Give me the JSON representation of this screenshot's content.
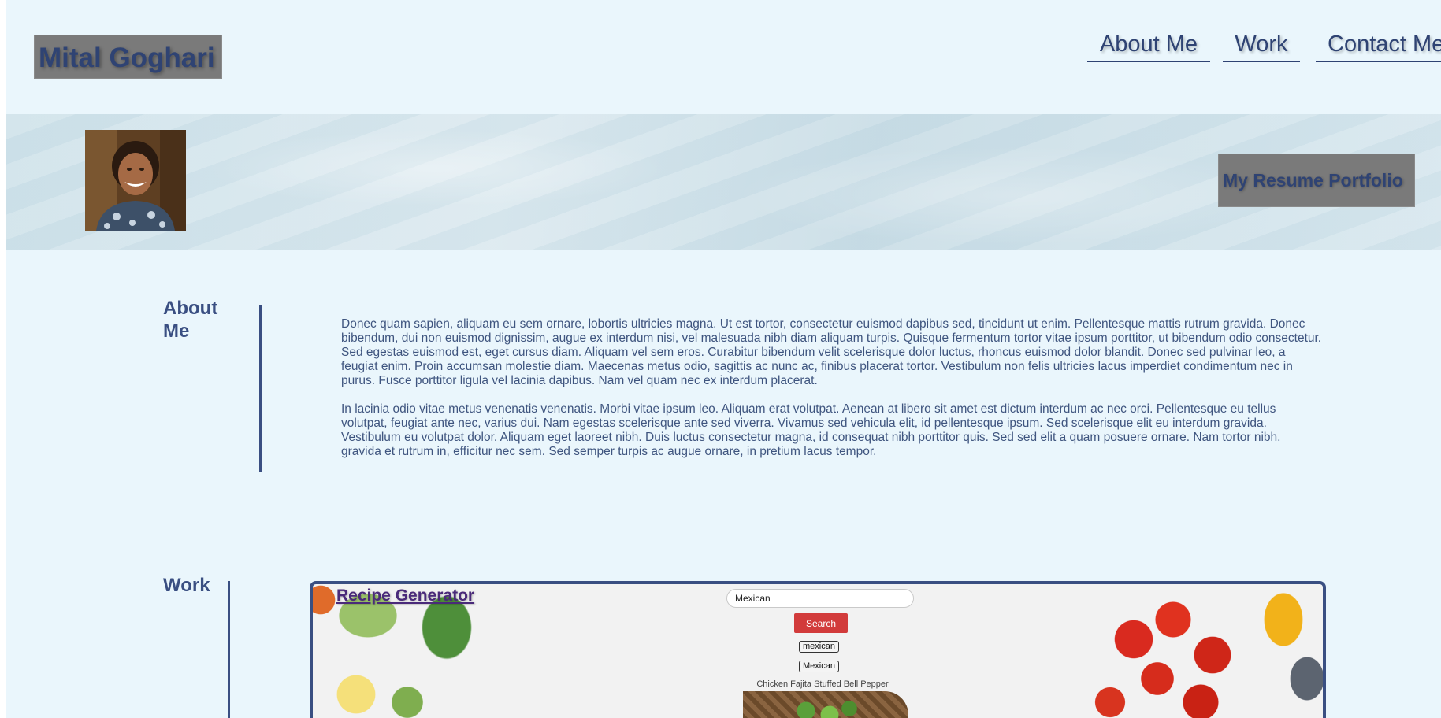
{
  "header": {
    "site_title": "Mital Goghari",
    "nav": {
      "about": "About Me",
      "work": "Work",
      "contact": "Contact Me"
    }
  },
  "banner": {
    "badge_text": "My Resume Portfolio",
    "avatar_icon": "profile-photo"
  },
  "about": {
    "heading": "About Me",
    "paragraphs": [
      "Donec quam sapien, aliquam eu sem ornare, lobortis ultricies magna. Ut est tortor, consectetur euismod dapibus sed, tincidunt ut enim. Pellentesque mattis rutrum gravida. Donec bibendum, dui non euismod dignissim, augue ex interdum nisi, vel malesuada nibh diam aliquam turpis. Quisque fermentum tortor vitae ipsum porttitor, ut bibendum odio consectetur. Sed egestas euismod est, eget cursus diam. Aliquam vel sem eros. Curabitur bibendum velit scelerisque dolor luctus, rhoncus euismod dolor blandit. Donec sed pulvinar leo, a feugiat enim. Proin accumsan molestie diam. Maecenas metus odio, sagittis ac nunc ac, finibus placerat tortor. Vestibulum non felis ultricies lacus imperdiet condimentum nec in purus. Fusce porttitor ligula vel lacinia dapibus. Nam vel quam nec ex interdum placerat.",
      "In lacinia odio vitae metus venenatis venenatis. Morbi vitae ipsum leo. Aliquam erat volutpat. Aenean at libero sit amet est dictum interdum ac nec orci. Pellentesque eu tellus volutpat, feugiat ante nec, varius dui. Nam egestas scelerisque ante sed viverra. Vivamus sed vehicula elit, id pellentesque ipsum. Sed scelerisque elit eu interdum gravida. Vestibulum eu volutpat dolor. Aliquam eget laoreet nibh. Duis luctus consectetur magna, id consequat nibh porttitor quis. Sed sed elit a quam posuere ornare. Nam tortor nibh, gravida et rutrum in, efficitur nec sem. Sed semper turpis ac augue ornare, in pretium lacus tempor."
    ]
  },
  "work": {
    "heading": "Work",
    "project": {
      "title": "Recipe Generator",
      "search_value": "Mexican",
      "search_button": "Search",
      "tags": [
        "mexican",
        "Mexican"
      ],
      "recipe_title": "Chicken Fajita Stuffed Bell Pepper"
    }
  },
  "colors": {
    "page_background": "#eaf6fc",
    "accent_navy": "#2f4373",
    "title_box_gray": "#7a7a7a",
    "search_red": "#d23b3b"
  }
}
